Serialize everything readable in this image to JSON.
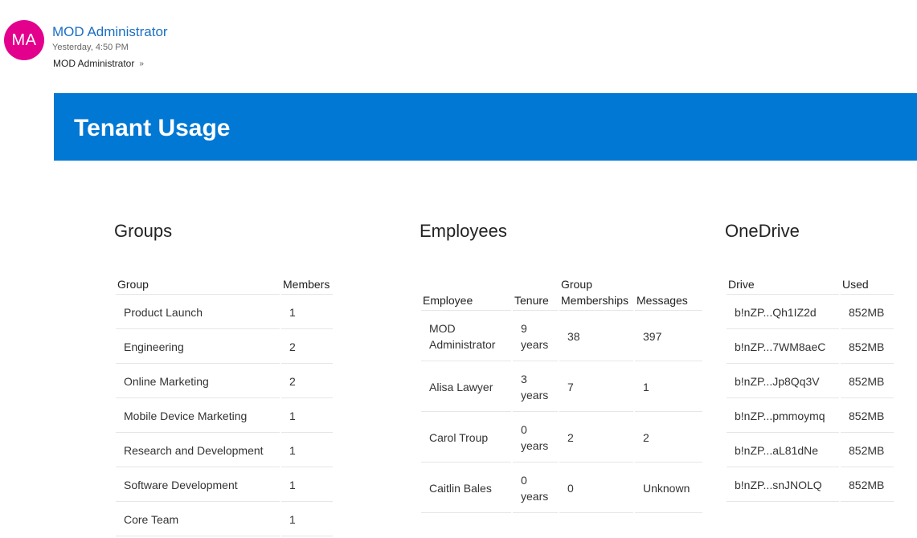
{
  "header": {
    "avatar_initials": "MA",
    "sender_name": "MOD Administrator",
    "timestamp": "Yesterday, 4:50 PM",
    "recipient": "MOD Administrator",
    "chevron_icon": "double-chevron-down-icon"
  },
  "banner": {
    "title": "Tenant Usage",
    "color": "#0078d4"
  },
  "avatar_color": "#e3008c",
  "groups": {
    "title": "Groups",
    "columns": [
      "Group",
      "Members"
    ],
    "rows": [
      [
        "Product Launch",
        "1"
      ],
      [
        "Engineering",
        "2"
      ],
      [
        "Online Marketing",
        "2"
      ],
      [
        "Mobile Device Marketing",
        "1"
      ],
      [
        "Research and Development",
        "1"
      ],
      [
        "Software Development",
        "1"
      ],
      [
        "Core Team",
        "1"
      ]
    ]
  },
  "employees": {
    "title": "Employees",
    "columns": [
      "Employee",
      "Tenure",
      "Group Memberships",
      "Messages"
    ],
    "rows": [
      [
        "MOD Administrator",
        "9 years",
        "38",
        "397"
      ],
      [
        "Alisa Lawyer",
        "3 years",
        "7",
        "1"
      ],
      [
        "Carol Troup",
        "0 years",
        "2",
        "2"
      ],
      [
        "Caitlin Bales",
        "0 years",
        "0",
        "Unknown"
      ]
    ]
  },
  "onedrive": {
    "title": "OneDrive",
    "columns": [
      "Drive",
      "Used"
    ],
    "rows": [
      [
        "b!nZP...Qh1IZ2d",
        "852MB"
      ],
      [
        "b!nZP...7WM8aeC",
        "852MB"
      ],
      [
        "b!nZP...Jp8Qq3V",
        "852MB"
      ],
      [
        "b!nZP...pmmoymq",
        "852MB"
      ],
      [
        "b!nZP...aL81dNe",
        "852MB"
      ],
      [
        "b!nZP...snJNOLQ",
        "852MB"
      ]
    ]
  }
}
